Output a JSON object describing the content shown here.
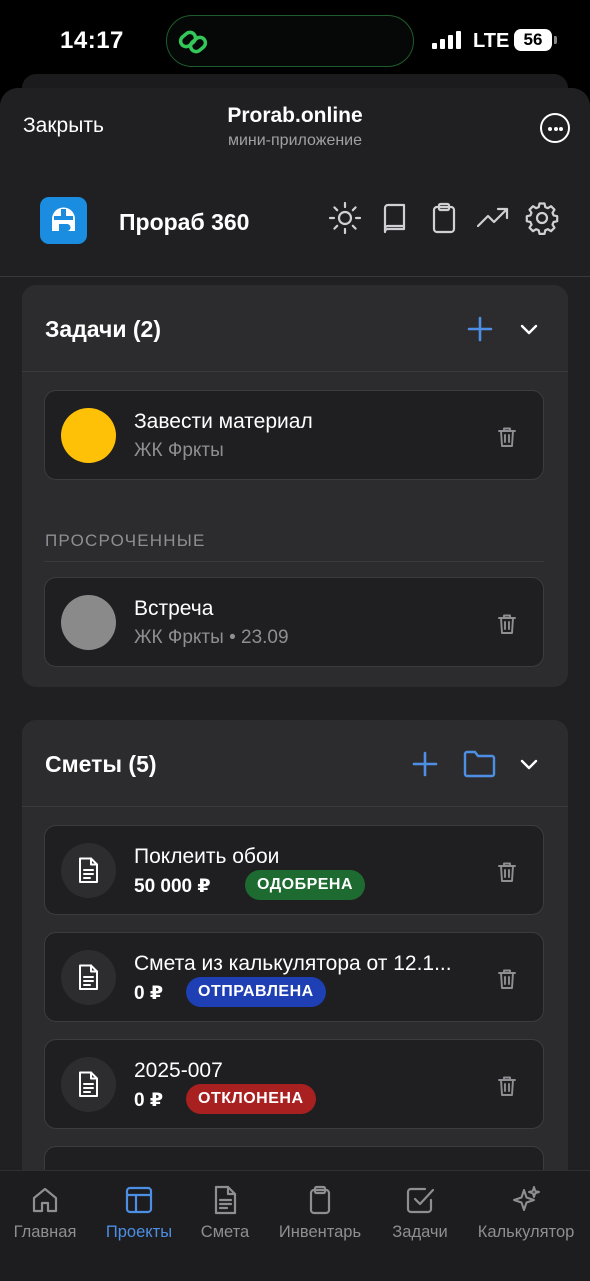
{
  "status_bar": {
    "time": "14:17",
    "network": "LTE",
    "battery": "56"
  },
  "mini_app": {
    "close_label": "Закрыть",
    "title": "Prorab.online",
    "subtitle": "мини-приложение"
  },
  "header": {
    "brand": "Прораб 360",
    "icons": [
      "sun-icon",
      "book-icon",
      "clipboard-icon",
      "trending-up-icon",
      "gear-icon"
    ]
  },
  "tasks": {
    "title": "Задачи (2)",
    "items": [
      {
        "title": "Завести материал",
        "subtitle": "ЖК Фркты",
        "color": "#ffc107"
      }
    ],
    "overdue_label": "ПРОСРОЧЕННЫЕ",
    "overdue": [
      {
        "title": "Встреча",
        "subtitle": "ЖК Фркты • 23.09",
        "color": "#8a8a8a"
      }
    ]
  },
  "estimates": {
    "title": "Сметы (5)",
    "items": [
      {
        "title": "Поклеить обои",
        "amount": "50 000 ₽",
        "status": "ОДОБРЕНА",
        "status_color": "#1e6b32"
      },
      {
        "title": "Смета из калькулятора от 12.1...",
        "amount": "0 ₽",
        "status": "ОТПРАВЛЕНА",
        "status_color": "#1f3fb5"
      },
      {
        "title": "2025-007",
        "amount": "0 ₽",
        "status": "ОТКЛОНЕНА",
        "status_color": "#a8201f"
      }
    ]
  },
  "tabbar": {
    "tabs": [
      {
        "label": "Главная",
        "icon": "home-icon"
      },
      {
        "label": "Проекты",
        "icon": "layout-icon",
        "active": true
      },
      {
        "label": "Смета",
        "icon": "document-icon"
      },
      {
        "label": "Инвентарь",
        "icon": "clipboard-icon"
      },
      {
        "label": "Задачи",
        "icon": "checkbox-icon"
      },
      {
        "label": "Калькулятор",
        "icon": "sparkles-icon"
      }
    ]
  },
  "colors": {
    "accent": "#4c8fe5",
    "background": "#202022",
    "card": "#2c2c2e"
  }
}
